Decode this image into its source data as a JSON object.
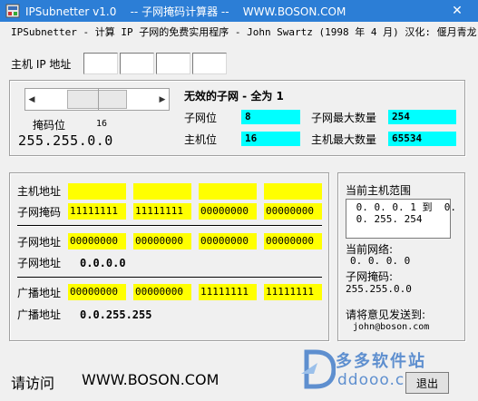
{
  "window": {
    "title": "IPSubnetter v1.0    -- 子网掩码计算器 --    WWW.BOSON.COM",
    "close_glyph": "✕"
  },
  "subtitle": "IPSubnetter - 计算 IP 子网的免费实用程序 - John Swartz (1998 年 4 月) 汉化: 偃月青龙",
  "host_ip": {
    "label": "主机 IP 地址",
    "octets": [
      "",
      "",
      "",
      ""
    ]
  },
  "mask_panel": {
    "mask_bits_label": "掩码位",
    "mask_bits_value": "16",
    "mask_dotted": "255.255.0.0",
    "slider_value_bits": 16,
    "arrow_left": "◀",
    "arrow_right": "▶"
  },
  "summary": {
    "invalid_title": "无效的子网 - 全为 1",
    "subnet_bits_label": "子网位",
    "subnet_bits_value": "8",
    "host_bits_label": "主机位",
    "host_bits_value": "16",
    "max_subnets_label": "子网最大数量",
    "max_subnets_value": "254",
    "max_hosts_label": "主机最大数量",
    "max_hosts_value": "65534"
  },
  "binary_table": {
    "host_address_label": "主机地址",
    "host_address_bits": [
      "",
      "",
      "",
      ""
    ],
    "subnet_mask_label": "子网掩码",
    "subnet_mask_bits": [
      "11111111",
      "11111111",
      "00000000",
      "00000000"
    ],
    "subnet_address_label": "子网地址",
    "subnet_address_bits": [
      "00000000",
      "00000000",
      "00000000",
      "00000000"
    ],
    "subnet_address_dotted_label": "子网地址",
    "subnet_address_dotted": "0.0.0.0",
    "broadcast_label": "广播地址",
    "broadcast_bits": [
      "00000000",
      "00000000",
      "11111111",
      "11111111"
    ],
    "broadcast_dotted_label": "广播地址",
    "broadcast_dotted": "0.0.255.255"
  },
  "range_panel": {
    "title": "当前主机范围",
    "range_text": " 0. 0. 0. 1 到  0.\n 0. 255. 254",
    "current_network_label": "当前网络:",
    "current_network_value": "0. 0. 0. 0",
    "subnet_mask_label": "子网掩码:",
    "subnet_mask_value": "255.255.0.0",
    "feedback_label": "请将意见发送到:",
    "feedback_email": "john@boson.com"
  },
  "footer": {
    "visit_label": "请访问",
    "website": "WWW.BOSON.COM",
    "exit_label": "退出"
  },
  "watermark": {
    "cn": "多多软件站",
    "en": "ddooo.com"
  },
  "colors": {
    "titlebar": "#2c7ed6",
    "cyan": "#00ffff",
    "yellow": "#ffff00",
    "watermark": "#2e6fc4"
  }
}
